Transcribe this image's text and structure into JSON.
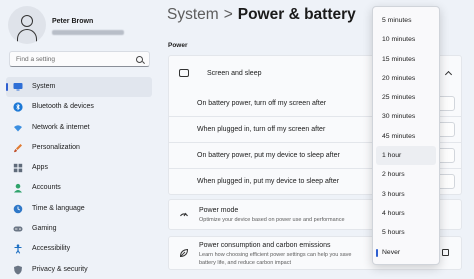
{
  "profile": {
    "name": "Peter Brown"
  },
  "search": {
    "placeholder": "Find a setting"
  },
  "sidebar": {
    "items": [
      {
        "label": "System",
        "icon": "monitor-icon",
        "active": true
      },
      {
        "label": "Bluetooth & devices",
        "icon": "bluetooth-icon"
      },
      {
        "label": "Network & internet",
        "icon": "wifi-icon"
      },
      {
        "label": "Personalization",
        "icon": "brush-icon"
      },
      {
        "label": "Apps",
        "icon": "apps-icon"
      },
      {
        "label": "Accounts",
        "icon": "person-icon"
      },
      {
        "label": "Time & language",
        "icon": "globe-clock-icon"
      },
      {
        "label": "Gaming",
        "icon": "gamepad-icon"
      },
      {
        "label": "Accessibility",
        "icon": "accessibility-icon"
      },
      {
        "label": "Privacy & security",
        "icon": "shield-icon"
      }
    ]
  },
  "header": {
    "parent": "System",
    "separator": ">",
    "current": "Power & battery"
  },
  "section": {
    "label": "Power"
  },
  "screen_sleep": {
    "title": "Screen and sleep",
    "rows": [
      {
        "label": "On battery power, turn off my screen after"
      },
      {
        "label": "When plugged in, turn off my screen after"
      },
      {
        "label": "On battery power, put my device to sleep after"
      },
      {
        "label": "When plugged in, put my device to sleep after"
      }
    ]
  },
  "power_mode": {
    "title": "Power mode",
    "description": "Optimize your device based on power use and performance"
  },
  "power_consumption": {
    "title": "Power consumption and carbon emissions",
    "description_line1": "Learn how choosing efficient power settings can help you save",
    "description_line2": "battery life, and reduce carbon impact"
  },
  "dropdown": {
    "options": [
      "5 minutes",
      "10 minutes",
      "15 minutes",
      "20 minutes",
      "25 minutes",
      "30 minutes",
      "45 minutes",
      "1 hour",
      "2 hours",
      "3 hours",
      "4 hours",
      "5 hours",
      "Never"
    ],
    "hovered": "1 hour",
    "selected": "Never"
  },
  "colors": {
    "accent": "#2f5fd0",
    "background": "#eef2f8",
    "card": "#f9fafc"
  }
}
